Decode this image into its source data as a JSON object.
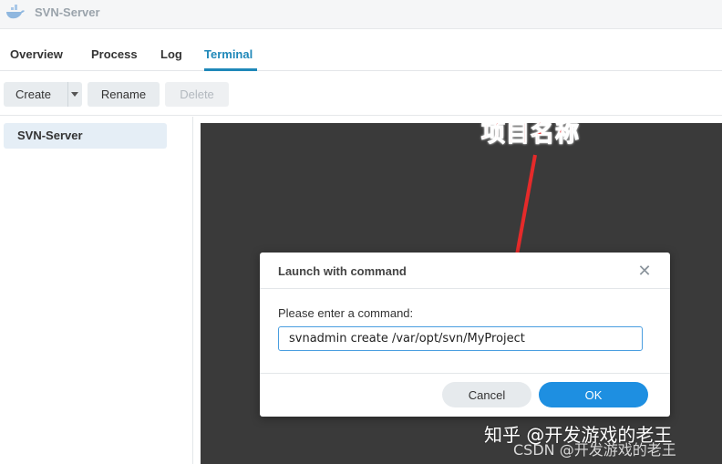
{
  "window": {
    "title": "SVN-Server",
    "icon": "docker-whale-icon"
  },
  "tabs": [
    {
      "label": "Overview",
      "active": false
    },
    {
      "label": "Process",
      "active": false
    },
    {
      "label": "Log",
      "active": false
    },
    {
      "label": "Terminal",
      "active": true
    }
  ],
  "toolbar": {
    "create_label": "Create",
    "rename_label": "Rename",
    "delete_label": "Delete"
  },
  "sidebar": {
    "items": [
      {
        "label": "SVN-Server",
        "selected": true
      }
    ]
  },
  "dialog": {
    "title": "Launch with command",
    "prompt": "Please enter a command:",
    "command_value": "svnadmin create /var/opt/svn/MyProject",
    "cancel_label": "Cancel",
    "ok_label": "OK"
  },
  "annotation": {
    "text": "项目名称",
    "color": "#e52a2a"
  },
  "watermarks": {
    "primary": "知乎 @开发游戏的老王",
    "secondary": "CSDN @开发游戏的老王"
  },
  "colors": {
    "accent": "#1f88b9",
    "ok_button": "#1e8fe1",
    "terminal_bg": "#3a3a3a"
  }
}
